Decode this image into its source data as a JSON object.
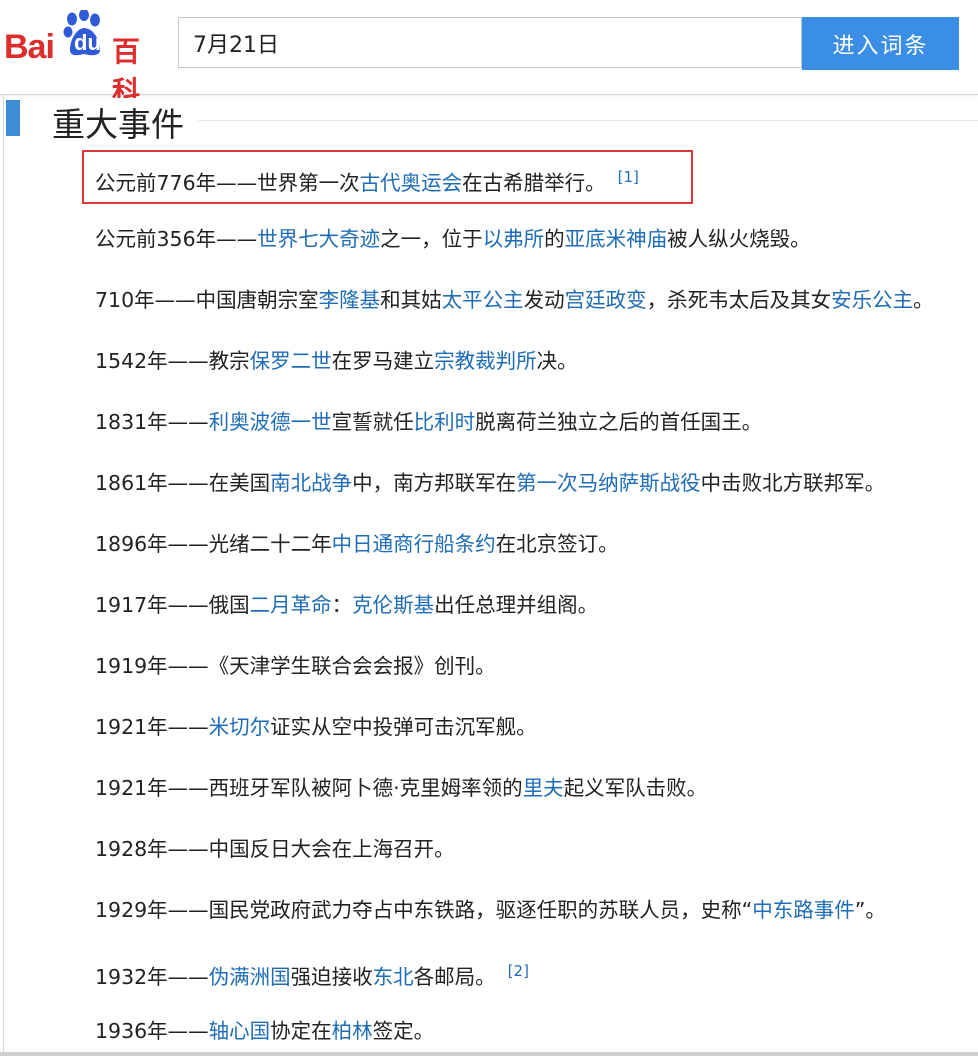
{
  "header": {
    "logo": {
      "bai": "Bai",
      "du": "du",
      "baike": "百科"
    },
    "search_value": "7月21日",
    "search_button": "进入词条"
  },
  "section": {
    "title": "重大事件"
  },
  "events": [
    {
      "segments": [
        {
          "t": "公元前776年——世界第一次"
        },
        {
          "t": "古代奥运会",
          "link": true
        },
        {
          "t": "在古希腊举行。"
        }
      ],
      "ref": "[1]",
      "highlighted": true
    },
    {
      "segments": [
        {
          "t": "公元前356年——"
        },
        {
          "t": "世界七大奇迹",
          "link": true
        },
        {
          "t": "之一，位于"
        },
        {
          "t": "以弗所",
          "link": true
        },
        {
          "t": "的"
        },
        {
          "t": "亚底米神庙",
          "link": true
        },
        {
          "t": "被人纵火烧毁。"
        }
      ]
    },
    {
      "segments": [
        {
          "t": "710年——中国唐朝宗室"
        },
        {
          "t": "李隆基",
          "link": true
        },
        {
          "t": "和其姑"
        },
        {
          "t": "太平公主",
          "link": true
        },
        {
          "t": "发动"
        },
        {
          "t": "宫廷政变",
          "link": true
        },
        {
          "t": "，杀死韦太后及其女"
        },
        {
          "t": "安乐公主",
          "link": true
        },
        {
          "t": "。"
        }
      ]
    },
    {
      "segments": [
        {
          "t": "1542年——教宗"
        },
        {
          "t": "保罗二世",
          "link": true
        },
        {
          "t": "在罗马建立"
        },
        {
          "t": "宗教裁判所",
          "link": true
        },
        {
          "t": "决。"
        }
      ]
    },
    {
      "segments": [
        {
          "t": "1831年——"
        },
        {
          "t": "利奥波德一世",
          "link": true
        },
        {
          "t": "宣誓就任"
        },
        {
          "t": "比利时",
          "link": true
        },
        {
          "t": "脱离荷兰独立之后的首任国王。"
        }
      ]
    },
    {
      "segments": [
        {
          "t": "1861年——在美国"
        },
        {
          "t": "南北战争",
          "link": true
        },
        {
          "t": "中，南方邦联军在"
        },
        {
          "t": "第一次马纳萨斯战役",
          "link": true
        },
        {
          "t": "中击败北方联邦军。"
        }
      ]
    },
    {
      "segments": [
        {
          "t": "1896年——光绪二十二年"
        },
        {
          "t": "中日通商行船条约",
          "link": true
        },
        {
          "t": "在北京签订。"
        }
      ]
    },
    {
      "segments": [
        {
          "t": "1917年——俄国"
        },
        {
          "t": "二月革命",
          "link": true
        },
        {
          "t": "："
        },
        {
          "t": "克伦斯基",
          "link": true
        },
        {
          "t": "出任总理并组阁。"
        }
      ]
    },
    {
      "segments": [
        {
          "t": "1919年——《天津学生联合会会报》创刊。"
        }
      ]
    },
    {
      "segments": [
        {
          "t": "1921年——"
        },
        {
          "t": "米切尔",
          "link": true
        },
        {
          "t": "证实从空中投弹可击沉军舰。"
        }
      ]
    },
    {
      "segments": [
        {
          "t": "1921年——西班牙军队被阿卜德·克里姆率领的"
        },
        {
          "t": "里夫",
          "link": true
        },
        {
          "t": "起义军队击败。"
        }
      ]
    },
    {
      "segments": [
        {
          "t": "1928年——中国反日大会在上海召开。"
        }
      ]
    },
    {
      "segments": [
        {
          "t": "1929年——国民党政府武力夺占中东铁路，驱逐任职的苏联人员，史称“"
        },
        {
          "t": "中东路事件",
          "link": true
        },
        {
          "t": "”。"
        }
      ]
    },
    {
      "segments": [
        {
          "t": "1932年——"
        },
        {
          "t": "伪满洲国",
          "link": true
        },
        {
          "t": "强迫接收"
        },
        {
          "t": "东北",
          "link": true
        },
        {
          "t": "各邮局。"
        }
      ],
      "ref": "[2]"
    },
    {
      "segments": [
        {
          "t": "1936年——"
        },
        {
          "t": "轴心国",
          "link": true
        },
        {
          "t": "协定在"
        },
        {
          "t": "柏林",
          "link": true
        },
        {
          "t": "签定。"
        }
      ]
    }
  ]
}
